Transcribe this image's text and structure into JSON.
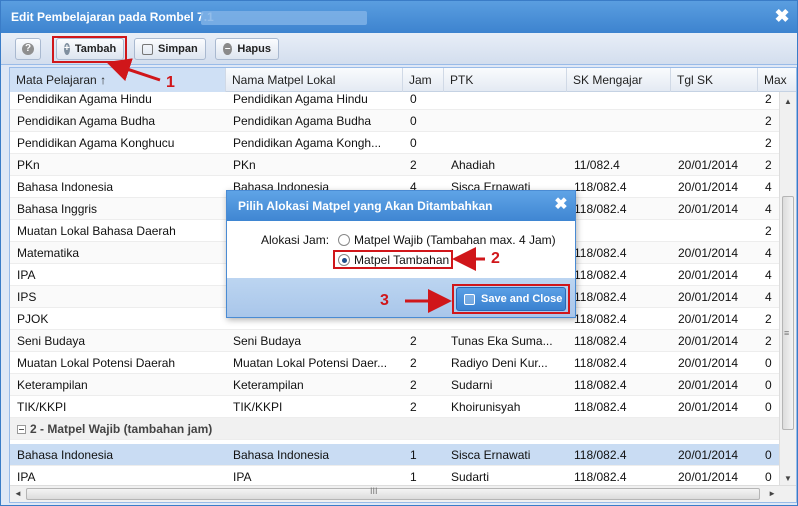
{
  "window": {
    "title": "Edit Pembelajaran pada Rombel 7.1",
    "close_glyph": "✖"
  },
  "toolbar": {
    "help_glyph": "?",
    "tambah_label": "Tambah",
    "tambah_glyph": "+",
    "simpan_label": "Simpan",
    "hapus_label": "Hapus",
    "hapus_glyph": "–"
  },
  "grid": {
    "columns": [
      "Mata Pelajaran",
      "Nama Matpel Lokal",
      "Jam",
      "PTK",
      "SK Mengajar",
      "Tgl SK",
      "Max"
    ],
    "sort_glyph": "↑",
    "rows": [
      {
        "mapel": "Pendidikan Agama Hindu",
        "lokal": "Pendidikan Agama Hindu",
        "jam": "0",
        "ptk": "",
        "sk": "",
        "tgl": "",
        "max": "2"
      },
      {
        "mapel": "Pendidikan Agama Budha",
        "lokal": "Pendidikan Agama Budha",
        "jam": "0",
        "ptk": "",
        "sk": "",
        "tgl": "",
        "max": "2"
      },
      {
        "mapel": "Pendidikan Agama Konghucu",
        "lokal": "Pendidikan Agama Kongh...",
        "jam": "0",
        "ptk": "",
        "sk": "",
        "tgl": "",
        "max": "2"
      },
      {
        "mapel": "PKn",
        "lokal": "PKn",
        "jam": "2",
        "ptk": "Ahadiah",
        "sk": "11/082.4",
        "tgl": "20/01/2014",
        "max": "2"
      },
      {
        "mapel": "Bahasa Indonesia",
        "lokal": "Bahasa Indonesia",
        "jam": "4",
        "ptk": "Sisca Ernawati",
        "sk": "118/082.4",
        "tgl": "20/01/2014",
        "max": "4"
      },
      {
        "mapel": "Bahasa Inggris",
        "lokal": "",
        "jam": "",
        "ptk": "",
        "sk": "118/082.4",
        "tgl": "20/01/2014",
        "max": "4"
      },
      {
        "mapel": "Muatan Lokal Bahasa Daerah",
        "lokal": "",
        "jam": "",
        "ptk": "",
        "sk": "",
        "tgl": "",
        "max": "2"
      },
      {
        "mapel": "Matematika",
        "lokal": "",
        "jam": "",
        "ptk": "",
        "sk": "118/082.4",
        "tgl": "20/01/2014",
        "max": "4"
      },
      {
        "mapel": "IPA",
        "lokal": "",
        "jam": "",
        "ptk": "",
        "sk": "118/082.4",
        "tgl": "20/01/2014",
        "max": "4"
      },
      {
        "mapel": "IPS",
        "lokal": "",
        "jam": "",
        "ptk": "",
        "sk": "118/082.4",
        "tgl": "20/01/2014",
        "max": "4"
      },
      {
        "mapel": "PJOK",
        "lokal": "",
        "jam": "",
        "ptk": "",
        "sk": "118/082.4",
        "tgl": "20/01/2014",
        "max": "2"
      },
      {
        "mapel": "Seni Budaya",
        "lokal": "Seni Budaya",
        "jam": "2",
        "ptk": "Tunas Eka Suma...",
        "sk": "118/082.4",
        "tgl": "20/01/2014",
        "max": "2"
      },
      {
        "mapel": "Muatan Lokal Potensi Daerah",
        "lokal": "Muatan Lokal Potensi Daer...",
        "jam": "2",
        "ptk": "Radiyo Deni Kur...",
        "sk": "118/082.4",
        "tgl": "20/01/2014",
        "max": "0"
      },
      {
        "mapel": "Keterampilan",
        "lokal": "Keterampilan",
        "jam": "2",
        "ptk": "Sudarni",
        "sk": "118/082.4",
        "tgl": "20/01/2014",
        "max": "0"
      },
      {
        "mapel": "TIK/KKPI",
        "lokal": "TIK/KKPI",
        "jam": "2",
        "ptk": "Khoirunisyah",
        "sk": "118/082.4",
        "tgl": "20/01/2014",
        "max": "0"
      }
    ],
    "group_label": "2 - Matpel Wajib (tambahan jam)",
    "group_rows": [
      {
        "mapel": "Bahasa Indonesia",
        "lokal": "Bahasa Indonesia",
        "jam": "1",
        "ptk": "Sisca Ernawati",
        "sk": "118/082.4",
        "tgl": "20/01/2014",
        "max": "0"
      },
      {
        "mapel": "IPA",
        "lokal": "IPA",
        "jam": "1",
        "ptk": "Sudarti",
        "sk": "118/082.4",
        "tgl": "20/01/2014",
        "max": "0"
      }
    ],
    "scroll": {
      "up": "▲",
      "down": "▼",
      "left": "◄",
      "right": "►",
      "v_grip": "≡",
      "h_grip": "III"
    }
  },
  "dialog": {
    "title": "Pilih Alokasi Matpel yang Akan Ditambahkan",
    "close_glyph": "✖",
    "alokasi_label": "Alokasi Jam:",
    "option_wajib": "Matpel Wajib (Tambahan max. 4 Jam)",
    "option_tambahan": "Matpel Tambahan",
    "selected": "tambahan",
    "save_label": "Save and Close"
  },
  "annotations": {
    "step1": "1",
    "step2": "2",
    "step3": "3"
  },
  "colors": {
    "annotation_red": "#d0161a",
    "title_blue": "#3d83cf",
    "selected_row": "#c9dcf3"
  }
}
